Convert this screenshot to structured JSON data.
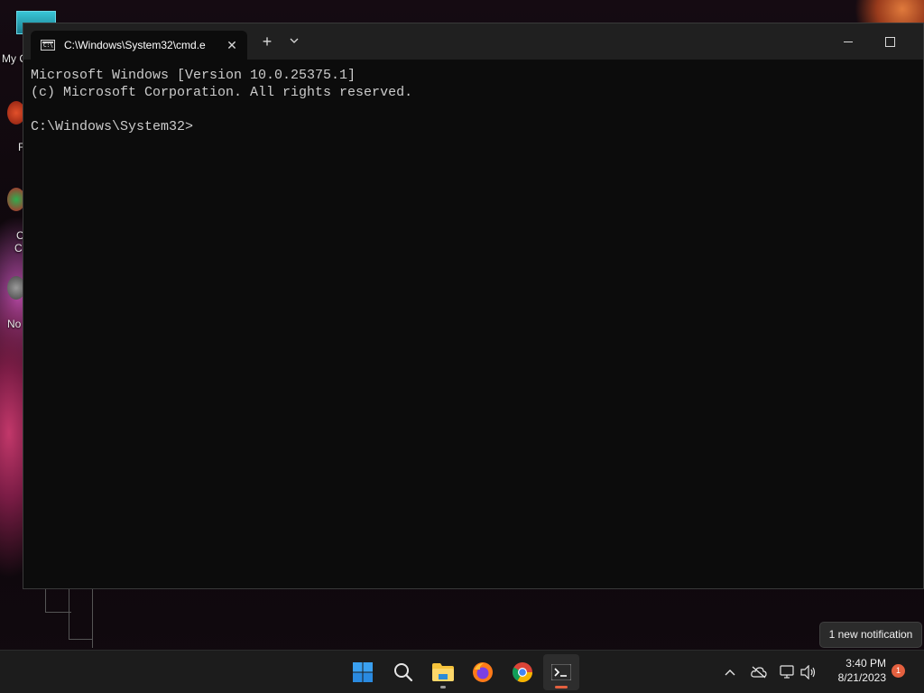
{
  "window": {
    "tab_title": "C:\\Windows\\System32\\cmd.e",
    "tab_icon_text": "C:\\",
    "new_tab_label": "+",
    "dropdown_label": "⌄",
    "close_tab_label": "✕"
  },
  "console": {
    "lines": [
      "Microsoft Windows [Version 10.0.25375.1]",
      "(c) Microsoft Corporation. All rights reserved.",
      "",
      "C:\\Windows\\System32>"
    ]
  },
  "desktop": {
    "icons": [
      {
        "label": "My C",
        "icon": "computer-icon"
      },
      {
        "label": "F",
        "icon": "app-shortcut-icon"
      },
      {
        "label": "C",
        "icon": "app-shortcut-icon"
      },
      {
        "label": "C",
        "icon": "app-shortcut-icon"
      },
      {
        "label": "No",
        "icon": "app-shortcut-icon"
      }
    ]
  },
  "taskbar": {
    "apps": [
      {
        "name": "start",
        "icon": "windows-logo-icon"
      },
      {
        "name": "search",
        "icon": "search-icon"
      },
      {
        "name": "file-explorer",
        "icon": "folder-icon"
      },
      {
        "name": "firefox",
        "icon": "firefox-icon"
      },
      {
        "name": "chrome",
        "icon": "chrome-icon"
      },
      {
        "name": "terminal",
        "icon": "terminal-icon"
      }
    ],
    "tray_icons": [
      "chevron-up-icon",
      "cloud-off-icon",
      "network-icon",
      "volume-icon"
    ],
    "time": "3:40 PM",
    "date": "8/21/2023",
    "notification_count": "1",
    "notification_tooltip": "1 new notification"
  },
  "colors": {
    "console_bg": "#0c0c0c",
    "console_text": "#cccccc",
    "titlebar_bg": "#202020",
    "taskbar_bg": "#1c1c1c",
    "accent": "#e4603f"
  }
}
